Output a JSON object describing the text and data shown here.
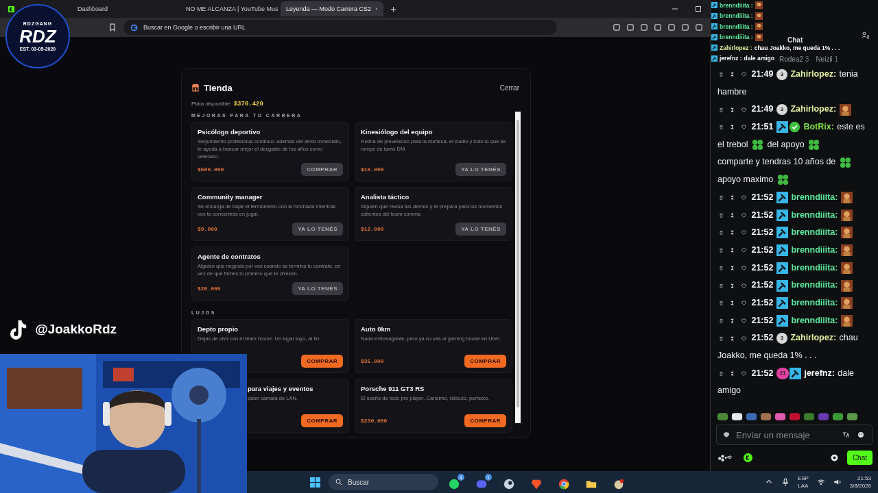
{
  "browser": {
    "tabs": [
      {
        "title": "Dashboard",
        "selected": false
      },
      {
        "title": "NO ME ALCANZA | YouTube Mus",
        "selected": false
      },
      {
        "title": "Leyenda — Modo Carrera CS2",
        "selected": true
      }
    ],
    "address": {
      "placeholder": "Buscar en Google o escribir una URL"
    }
  },
  "shop": {
    "title": "Tienda",
    "close": "Cerrar",
    "balance_label": "Plata disponible:",
    "balance": "$370.420",
    "sections": [
      {
        "heading": "MEJORAS PARA TU CARRERA",
        "items": [
          {
            "title": "Psicólogo deportivo",
            "description": "Seguimiento profesional continuo: además del alivio inmediato, te ayuda a bancar mejor el desgaste de los años como veterano.",
            "price": "$500.000",
            "button": {
              "label": "COMPRAR",
              "kind": "buy",
              "disabled": true
            }
          },
          {
            "title": "Kinesiólogo del equipo",
            "description": "Rutina de prevención para la muñeca, el cuello y todo lo que se rompe de tanto DM.",
            "price": "$10.000",
            "button": {
              "label": "YA LO TENÉS",
              "kind": "owned",
              "disabled": true
            }
          },
          {
            "title": "Community manager",
            "description": "Se encarga de bajar el termómetro con la hinchada mientras vos te concentrás en jugar.",
            "price": "$9.000",
            "button": {
              "label": "YA LO TENÉS",
              "kind": "owned",
              "disabled": true
            }
          },
          {
            "title": "Analista táctico",
            "description": "Alguien que revisa tus demos y te prepara para los momentos calientes del team comms.",
            "price": "$12.000",
            "button": {
              "label": "YA LO TENÉS",
              "kind": "owned",
              "disabled": true
            }
          },
          {
            "title": "Agente de contratos",
            "description": "Alguien que negocia por vos cuando se termina tu contrato, en vez de que firmes lo primero que te ofrecen.",
            "price": "$20.000",
            "button": {
              "label": "YA LO TENÉS",
              "kind": "owned",
              "disabled": true
            }
          }
        ]
      },
      {
        "heading": "LUJOS",
        "items": [
          {
            "title": "Depto propio",
            "description": "Dejás de vivir con el team house. Un lugar tuyo, al fin.",
            "button": {
              "label": "COMPRAR",
              "kind": "buy",
              "disabled": false
            }
          },
          {
            "title": "Auto 0km",
            "description": "Nada extravagante, pero ya no vas al gaming house en Uber.",
            "price": "$35.000",
            "button": {
              "label": "COMPRAR",
              "kind": "buy",
              "disabled": false
            }
          },
          {
            "title": "para viajes y eventos",
            "description": "quier cámara de LAN.",
            "partly_hidden": true,
            "button": {
              "label": "COMPRAR",
              "kind": "buy",
              "disabled": false
            }
          },
          {
            "title": "Porsche 911 GT3 RS",
            "description": "El sueño de todo pro player. Carísimo, ridículo, perfecto.",
            "price": "$230.000",
            "button": {
              "label": "COMPRAR",
              "kind": "buy",
              "disabled": false
            }
          }
        ]
      }
    ]
  },
  "overlay": {
    "logo": {
      "top": "RDZGANG",
      "center": "RDZ",
      "bottom": "EST. 03-05-2020"
    },
    "tiktok": {
      "handle": "@JoakkoRdz"
    },
    "chat_lines": [
      {
        "user": "brenndiiita :",
        "color": "#5de8a0",
        "emote": true
      },
      {
        "user": "brenndiiita :",
        "color": "#5de8a0",
        "emote": true
      },
      {
        "user": "brenndiiita :",
        "color": "#5de8a0",
        "emote": true
      },
      {
        "user": "brenndiiita :",
        "color": "#5de8a0",
        "emote": true
      },
      {
        "user": "Zahirlopez :",
        "text": "chau Joakko, me queda 1% . . .",
        "color": "#e4f0a0",
        "emote": false
      },
      {
        "user": "jerefnz :",
        "text": "dale amigo",
        "color": "#ffffff",
        "emote": false
      }
    ]
  },
  "chat": {
    "title": "Chat",
    "top_chatters": [
      {
        "name": "Rodea2",
        "count": "3"
      },
      {
        "name": "Neizii",
        "count": "1"
      }
    ],
    "messages": [
      {
        "time": "21:49",
        "badges": [
          {
            "kind": "sub",
            "label": "3"
          }
        ],
        "user": "Zahirlopez:",
        "color": "#e4f0a0",
        "parts": [
          {
            "kind": "text",
            "text": "tenia"
          },
          {
            "kind": "text",
            "text": "hambre"
          }
        ]
      },
      {
        "time": "21:49",
        "badges": [
          {
            "kind": "sub",
            "label": "3"
          }
        ],
        "user": "Zahirlopez:",
        "color": "#e4f0a0",
        "parts": [
          {
            "kind": "emote"
          }
        ]
      },
      {
        "time": "21:51",
        "badges": [
          {
            "kind": "mod"
          },
          {
            "kind": "verified"
          }
        ],
        "user": "BotRix:",
        "color": "#7de04a",
        "parts": [
          {
            "kind": "text",
            "text": "este es"
          },
          {
            "kind": "text",
            "text": "el trebol"
          },
          {
            "kind": "clover"
          },
          {
            "kind": "text",
            "text": "del apoyo"
          },
          {
            "kind": "clover"
          },
          {
            "kind": "text",
            "text": "comparte y tendras 10 años de"
          },
          {
            "kind": "clover"
          },
          {
            "kind": "text",
            "text": "apoyo maximo"
          },
          {
            "kind": "clover"
          }
        ]
      },
      {
        "time": "21:52",
        "badges": [
          {
            "kind": "mod"
          }
        ],
        "user": "brenndiiita:",
        "color": "#5de8a0",
        "parts": [
          {
            "kind": "emote"
          }
        ]
      },
      {
        "time": "21:52",
        "badges": [
          {
            "kind": "mod"
          }
        ],
        "user": "brenndiiita:",
        "color": "#5de8a0",
        "parts": [
          {
            "kind": "emote"
          }
        ]
      },
      {
        "time": "21:52",
        "badges": [
          {
            "kind": "mod"
          }
        ],
        "user": "brenndiiita:",
        "color": "#5de8a0",
        "parts": [
          {
            "kind": "emote"
          }
        ]
      },
      {
        "time": "21:52",
        "badges": [
          {
            "kind": "mod"
          }
        ],
        "user": "brenndiiita:",
        "color": "#5de8a0",
        "parts": [
          {
            "kind": "emote"
          }
        ]
      },
      {
        "time": "21:52",
        "badges": [
          {
            "kind": "mod"
          }
        ],
        "user": "brenndiiita:",
        "color": "#5de8a0",
        "parts": [
          {
            "kind": "emote"
          }
        ]
      },
      {
        "time": "21:52",
        "badges": [
          {
            "kind": "mod"
          }
        ],
        "user": "brenndiiita:",
        "color": "#5de8a0",
        "parts": [
          {
            "kind": "emote"
          }
        ]
      },
      {
        "time": "21:52",
        "badges": [
          {
            "kind": "mod"
          }
        ],
        "user": "brenndiiita:",
        "color": "#5de8a0",
        "parts": [
          {
            "kind": "emote"
          }
        ]
      },
      {
        "time": "21:52",
        "badges": [
          {
            "kind": "mod"
          }
        ],
        "user": "brenndiiita:",
        "color": "#5de8a0",
        "parts": [
          {
            "kind": "emote"
          }
        ]
      },
      {
        "time": "21:52",
        "badges": [
          {
            "kind": "sub",
            "label": "3"
          }
        ],
        "user": "Zahirlopez:",
        "color": "#e4f0a0",
        "parts": [
          {
            "kind": "text",
            "text": "chau"
          },
          {
            "kind": "text",
            "text": "Joakko, me queda 1% . . ."
          }
        ]
      },
      {
        "time": "21:52",
        "badges": [
          {
            "kind": "gifter",
            "label": "21"
          },
          {
            "kind": "mod"
          }
        ],
        "user": "jerefnz:",
        "color": "#ffffff",
        "parts": [
          {
            "kind": "text",
            "text": "dale"
          },
          {
            "kind": "text",
            "text": "amigo"
          }
        ]
      }
    ],
    "input": {
      "placeholder": "Enviar un mensaje"
    },
    "send": "Chat"
  },
  "taskbar": {
    "search": "Buscar",
    "apps": [
      {
        "kind": "whatsapp",
        "badge": "4"
      },
      {
        "kind": "discord",
        "badge": "1"
      },
      {
        "kind": "steam"
      },
      {
        "kind": "brave"
      },
      {
        "kind": "chrome"
      },
      {
        "kind": "folder"
      },
      {
        "kind": "game"
      }
    ],
    "language": "ESP",
    "layout": "LAA",
    "time": "21:53",
    "date": "3/8/2026"
  }
}
